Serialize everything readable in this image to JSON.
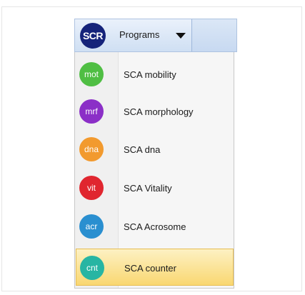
{
  "toolbar": {
    "badge": "SCR",
    "programs_label": "Programs"
  },
  "menu": {
    "items": [
      {
        "icon_text": "mot",
        "icon_name": "mobility-icon",
        "label": "SCA mobility",
        "color": "#4fbe43"
      },
      {
        "icon_text": "mrf",
        "icon_name": "morphology-icon",
        "label": "SCA morphology",
        "color": "#8b2fc7"
      },
      {
        "icon_text": "dna",
        "icon_name": "dna-icon",
        "label": "SCA dna",
        "color": "#f29a2e"
      },
      {
        "icon_text": "vit",
        "icon_name": "vitality-icon",
        "label": "SCA Vitality",
        "color": "#e0262f"
      },
      {
        "icon_text": "acr",
        "icon_name": "acrosome-icon",
        "label": "SCA Acrosome",
        "color": "#2a8fd0"
      },
      {
        "icon_text": "cnt",
        "icon_name": "counter-icon",
        "label": "SCA counter",
        "color": "#27b5a3"
      }
    ],
    "active_index": 5
  },
  "colors": {
    "badge_bg": "#15237a",
    "highlight_bg": "#f9d771"
  }
}
